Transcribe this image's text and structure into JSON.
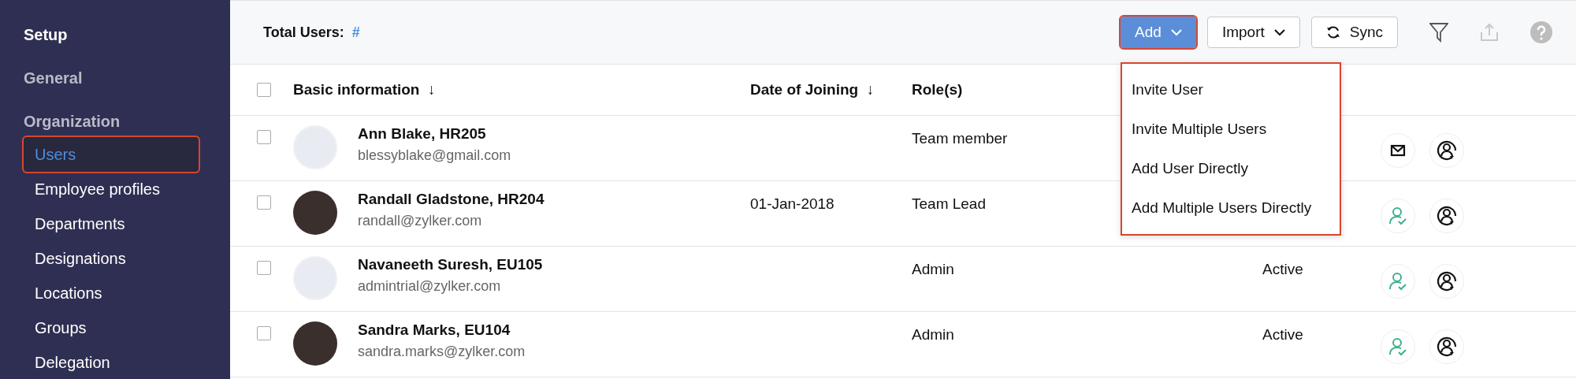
{
  "sidebar": {
    "title": "Setup",
    "sections": [
      {
        "label": "General"
      },
      {
        "label": "Organization",
        "items": [
          {
            "label": "Users",
            "selected": true
          },
          {
            "label": "Employee profiles",
            "selected": false
          },
          {
            "label": "Departments",
            "selected": false
          },
          {
            "label": "Designations",
            "selected": false
          },
          {
            "label": "Locations",
            "selected": false
          },
          {
            "label": "Groups",
            "selected": false
          },
          {
            "label": "Delegation",
            "selected": false
          }
        ]
      }
    ]
  },
  "toolbar": {
    "total_label": "Total Users:",
    "total_value": "#",
    "add_button": "Add",
    "import_button": "Import",
    "sync_button": "Sync"
  },
  "add_menu": {
    "open": true,
    "items": [
      "Invite User",
      "Invite Multiple Users",
      "Add User Directly",
      "Add Multiple Users Directly"
    ]
  },
  "table": {
    "header_checked": false,
    "columns": [
      {
        "label": "Basic information",
        "sort": "↓"
      },
      {
        "label": "Date of Joining",
        "sort": "↓"
      },
      {
        "label": "Role(s)"
      }
    ],
    "rows": [
      {
        "checked": false,
        "avatar": {
          "kind": "placeholder"
        },
        "name": "Ann Blake, HR205",
        "email": "blessyblake@gmail.com",
        "role": "Team member",
        "action": {
          "kind": "mail"
        }
      },
      {
        "checked": false,
        "avatar": {
          "kind": "photo"
        },
        "name": "Randall Gladstone, HR204",
        "email": "randall@zylker.com",
        "joined": "01-Jan-2018",
        "role": "Team Lead",
        "action": {
          "kind": "user-check"
        }
      },
      {
        "checked": false,
        "avatar": {
          "kind": "placeholder"
        },
        "name": "Navaneeth Suresh, EU105",
        "email": "admintrial@zylker.com",
        "role": "Admin",
        "status": "Active",
        "action": {
          "kind": "user-check"
        }
      },
      {
        "checked": false,
        "avatar": {
          "kind": "photo"
        },
        "name": "Sandra Marks, EU104",
        "email": "sandra.marks@zylker.com",
        "role": "Admin",
        "status": "Active",
        "action": {
          "kind": "user-check"
        }
      }
    ]
  }
}
